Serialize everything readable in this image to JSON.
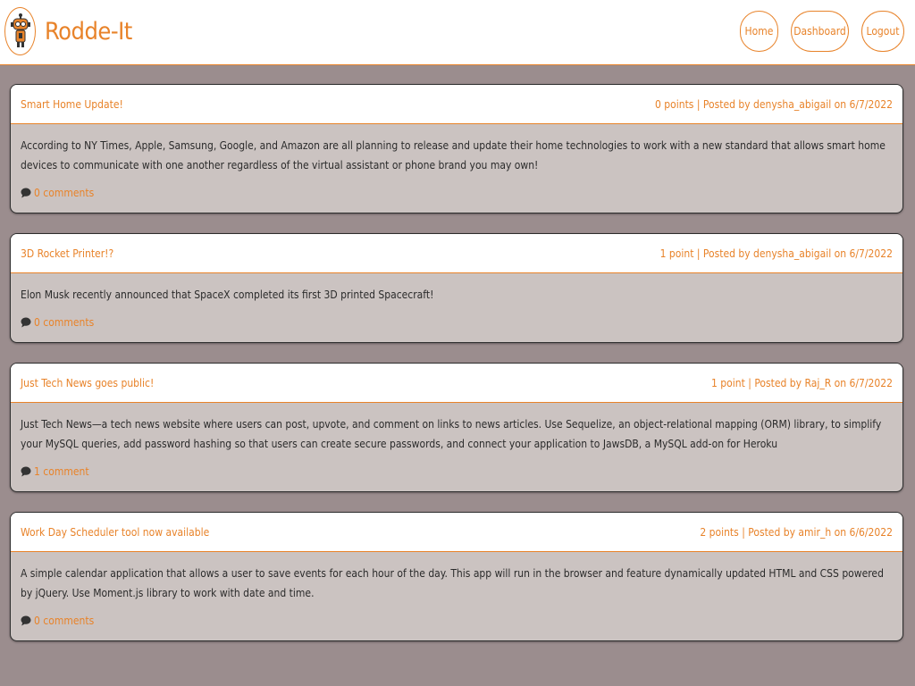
{
  "site": {
    "title": "Rodde-It",
    "brand_color": "#e8832a",
    "logo_icon": "robot-icon"
  },
  "nav": {
    "home": "Home",
    "dashboard": "Dashboard",
    "logout": "Logout"
  },
  "posts": [
    {
      "title": "Smart Home Update!",
      "meta": "0 points | Posted by denysha_abigail on 6/7/2022",
      "body": "According to NY Times, Apple, Samsung, Google, and Amazon are all planning to release and update their home technologies to work with a new standard that allows smart home devices to communicate with one another regardless of the virtual assistant or phone brand you may own!",
      "comments": "0 comments"
    },
    {
      "title": "3D Rocket Printer!?",
      "meta": "1 point | Posted by denysha_abigail on 6/7/2022",
      "body": "Elon Musk recently announced that SpaceX completed its first 3D printed Spacecraft!",
      "comments": "0 comments"
    },
    {
      "title": "Just Tech News goes public!",
      "meta": "1 point | Posted by Raj_R on 6/7/2022",
      "body": "Just Tech News—a tech news website where users can post, upvote, and comment on links to news articles. Use Sequelize, an object-relational mapping (ORM) library, to simplify your MySQL queries, add password hashing so that users can create secure passwords, and connect your application to JawsDB, a MySQL add-on for Heroku",
      "comments": "1 comment"
    },
    {
      "title": "Work Day Scheduler tool now available",
      "meta": "2 points | Posted by amir_h on 6/6/2022",
      "body": "A simple calendar application that allows a user to save events for each hour of the day. This app will run in the browser and feature dynamically updated HTML and CSS powered by jQuery. Use Moment.js library to work with date and time.",
      "comments": "0 comments"
    }
  ]
}
